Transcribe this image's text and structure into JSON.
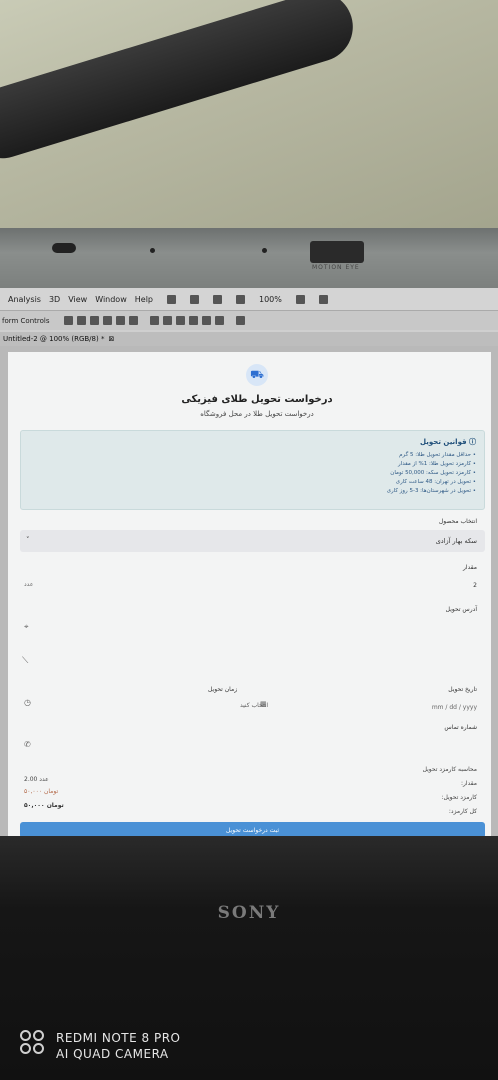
{
  "photo": {
    "camera_label": "MOTION EYE",
    "brand": "SONY",
    "watermark_line1": "REDMI NOTE 8 PRO",
    "watermark_line2": "AI QUAD CAMERA"
  },
  "app": {
    "menu": [
      "Analysis",
      "3D",
      "View",
      "Window",
      "Help"
    ],
    "zoom": "100%",
    "options_label": "form Controls",
    "tab_title": "Untitled-2 @ 100% (RGB/8) *"
  },
  "form": {
    "title": "درخواست تحویل طلای فیزیکی",
    "subtitle": "درخواست تحویل طلا در محل فروشگاه",
    "rules_title": "قوانین تحویل",
    "rules": [
      "• حداقل مقدار تحویل طلا: 5 گرم",
      "• کارمزد تحویل طلا: 1% از مقدار",
      "• کارمزد تحویل سکه: 50,000 تومان",
      "• تحویل در تهران: 48 ساعت کاری",
      "• تحویل در شهرستان‌ها: 3-5 روز کاری"
    ],
    "product_label": "انتخاب محصول",
    "product_value": "سکه بهار آزادی",
    "quantity_label": "مقدار",
    "quantity_value": "2",
    "quantity_unit": "عدد",
    "address_label": "آدرس تحویل",
    "time_label": "زمان تحویل",
    "time_value": "انتخاب کنید",
    "date_label": "تاریخ تحویل",
    "date_placeholder": "mm / dd / yyyy",
    "phone_label": "شماره تماس",
    "calc_title": "محاسبه کارمزد تحویل",
    "calc_amount_label": "مقدار:",
    "calc_amount_value": "2.00 عدد",
    "calc_fee_label": "کارمزد تحویل:",
    "calc_fee_value": "۵۰,۰۰۰ تومان",
    "calc_total_label": "کل کارمزد:",
    "calc_total_value": "۵۰,۰۰۰ تومان",
    "submit_label": "ثبت درخواست تحویل"
  }
}
